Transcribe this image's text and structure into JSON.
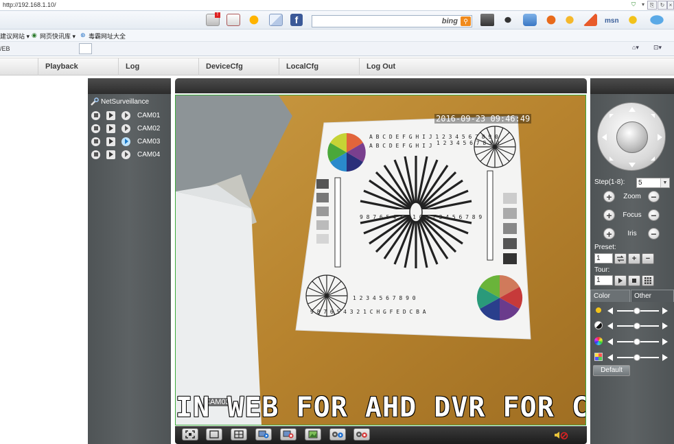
{
  "browser": {
    "url": "http://192.168.1.10/",
    "search_engine": "bing",
    "msn_label": "msn",
    "links_bar": {
      "item1": "建议网站 ▾",
      "item2": "网页快讯库 ▾",
      "item3": "毒霸网址大全"
    },
    "tab_title": "/EB",
    "accent_color": "#f08a1c"
  },
  "app": {
    "nav": [
      {
        "label": "Playback"
      },
      {
        "label": "Log"
      },
      {
        "label": "DeviceCfg"
      },
      {
        "label": "LocalCfg"
      },
      {
        "label": "Log Out"
      }
    ],
    "tree": {
      "root_label": "NetSurveillance",
      "cameras": [
        {
          "label": "CAM01"
        },
        {
          "label": "CAM02"
        },
        {
          "label": "CAM03"
        },
        {
          "label": "CAM04"
        }
      ]
    },
    "video": {
      "timestamp": "2016-09-23 09:46:49",
      "camera_label": "CAM03",
      "caption": "IN WEB FOR AHD DVR FOR CAM",
      "border_color": "#3aa83a"
    },
    "ptz": {
      "step_label": "Step(1-8):",
      "step_value": "5",
      "zoom_label": "Zoom",
      "focus_label": "Focus",
      "iris_label": "Iris",
      "preset_label": "Preset:",
      "preset_value": "1",
      "tour_label": "Tour:",
      "tour_value": "1"
    },
    "image_settings": {
      "tabs": [
        {
          "label": "Color"
        },
        {
          "label": "Other"
        }
      ],
      "default_label": "Default"
    }
  }
}
